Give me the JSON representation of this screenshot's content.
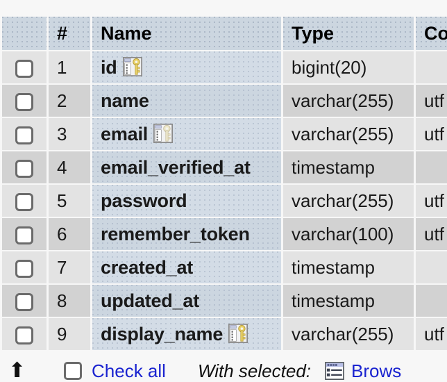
{
  "table": {
    "headers": {
      "check": "",
      "num": "#",
      "name": "Name",
      "type": "Type",
      "collation": "Co"
    },
    "rows": [
      {
        "num": "1",
        "name": "id",
        "type": "bigint(20)",
        "collation": "",
        "key": "primary"
      },
      {
        "num": "2",
        "name": "name",
        "type": "varchar(255)",
        "collation": "utf",
        "key": "none"
      },
      {
        "num": "3",
        "name": "email",
        "type": "varchar(255)",
        "collation": "utf",
        "key": "unique"
      },
      {
        "num": "4",
        "name": "email_verified_at",
        "type": "timestamp",
        "collation": "",
        "key": "none"
      },
      {
        "num": "5",
        "name": "password",
        "type": "varchar(255)",
        "collation": "utf",
        "key": "none"
      },
      {
        "num": "6",
        "name": "remember_token",
        "type": "varchar(100)",
        "collation": "utf",
        "key": "none"
      },
      {
        "num": "7",
        "name": "created_at",
        "type": "timestamp",
        "collation": "",
        "key": "none"
      },
      {
        "num": "8",
        "name": "updated_at",
        "type": "timestamp",
        "collation": "",
        "key": "none"
      },
      {
        "num": "9",
        "name": "display_name",
        "type": "varchar(255)",
        "collation": "utf",
        "key": "primary"
      }
    ]
  },
  "action_bar": {
    "scroll_up_icon": "arrow-up-icon",
    "check_all_label": "Check all",
    "with_selected_label": "With selected:",
    "browse_icon": "browse-icon",
    "browse_label": "Brows"
  },
  "colors": {
    "header_bg": "#ccd6e0",
    "row_odd_bg": "#e3e3e3",
    "row_even_bg": "#d2d2d2",
    "marked_col_bg": "#d3dce6",
    "link": "#1a23d0",
    "key_primary": "#ead26a",
    "key_unique": "#e8e4cf"
  }
}
